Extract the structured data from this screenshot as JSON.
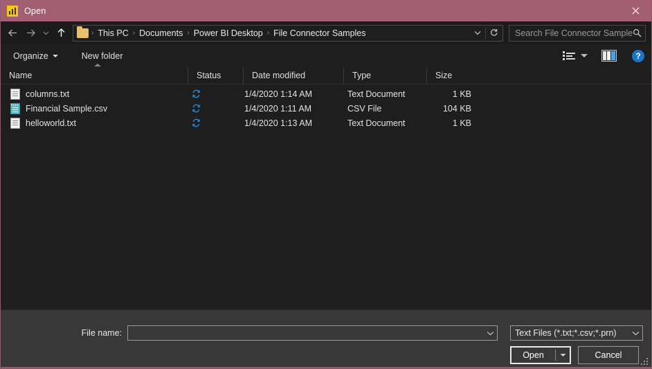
{
  "titlebar": {
    "title": "Open",
    "app_icon": "power-bi-icon",
    "close_label": "✕",
    "bg_color": "#a25f74"
  },
  "nav": {
    "back": "back-arrow",
    "forward": "forward-arrow",
    "recent": "recent-locations-chevron",
    "up": "up-arrow",
    "breadcrumbs": [
      {
        "label": "This PC"
      },
      {
        "label": "Documents"
      },
      {
        "label": "Power BI Desktop"
      },
      {
        "label": "File Connector Samples"
      }
    ],
    "separator": "›",
    "dropdown_icon": "chevron-down-icon",
    "refresh_icon": "refresh-icon"
  },
  "search": {
    "placeholder": "Search File Connector Samples",
    "value": "",
    "icon": "search-icon"
  },
  "toolbar": {
    "organize_label": "Organize",
    "new_folder_label": "New folder",
    "view_icon": "list-view-icon",
    "view_caret": "chevron-down-icon",
    "preview_pane_icon": "preview-pane-icon",
    "help_label": "?"
  },
  "columns": [
    {
      "label": "Name",
      "key": "name"
    },
    {
      "label": "Status",
      "key": "status"
    },
    {
      "label": "Date modified",
      "key": "date"
    },
    {
      "label": "Type",
      "key": "type"
    },
    {
      "label": "Size",
      "key": "size"
    }
  ],
  "sort": {
    "column": "Name",
    "direction": "ascending"
  },
  "files": [
    {
      "name": "columns.txt",
      "icon": "text-file-icon",
      "status": "sync-pending-icon",
      "date": "1/4/2020 1:14 AM",
      "type": "Text Document",
      "size": "1 KB"
    },
    {
      "name": "Financial Sample.csv",
      "icon": "csv-file-icon",
      "status": "sync-pending-icon",
      "date": "1/4/2020 1:11 AM",
      "type": "CSV File",
      "size": "104 KB"
    },
    {
      "name": "helloworld.txt",
      "icon": "text-file-icon",
      "status": "sync-pending-icon",
      "date": "1/4/2020 1:13 AM",
      "type": "Text Document",
      "size": "1 KB"
    }
  ],
  "footer": {
    "filename_label": "File name:",
    "filename_value": "",
    "filetype_value": "Text Files (*.txt;*.csv;*.prn)",
    "open_label": "Open",
    "cancel_label": "Cancel",
    "open_caret": "chevron-down-icon",
    "resize_grip": "resize-grip"
  }
}
